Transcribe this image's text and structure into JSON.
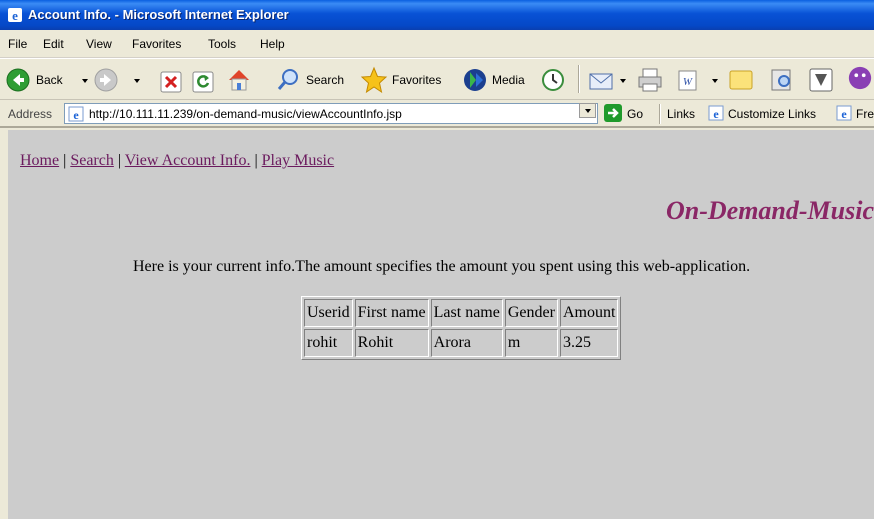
{
  "window": {
    "title": "Account Info. - Microsoft Internet Explorer"
  },
  "menu": [
    "File",
    "Edit",
    "View",
    "Favorites",
    "Tools",
    "Help"
  ],
  "toolbar": {
    "back": "Back",
    "search": "Search",
    "favorites": "Favorites",
    "media": "Media"
  },
  "address": {
    "label": "Address",
    "url": "http://10.111.11.239/on-demand-music/viewAccountInfo.jsp",
    "go": "Go",
    "links": "Links",
    "customize_links": "Customize Links",
    "free": "Fre"
  },
  "page": {
    "nav": [
      "Home",
      "Search",
      "View Account Info.",
      "Play Music"
    ],
    "nav_separator": "|",
    "brand": "On-Demand-Music",
    "info": "Here is your current info.The amount specifies the amount you spent using this web-application.",
    "table": {
      "headers": [
        "Userid",
        "First name",
        "Last name",
        "Gender",
        "Amount"
      ],
      "rows": [
        [
          "rohit",
          "Rohit",
          "Arora",
          "m",
          "3.25"
        ]
      ]
    }
  },
  "colors": {
    "content_bg": "#cccccc",
    "link": "#6b1a5e",
    "brand": "#8a2766",
    "titlebar": "#0852d6"
  },
  "icons": [
    "ie-logo-icon",
    "back-icon",
    "forward-icon",
    "stop-icon",
    "refresh-icon",
    "home-icon",
    "search-icon",
    "favorites-star-icon",
    "media-icon",
    "history-icon",
    "mail-icon",
    "print-icon",
    "edit-icon",
    "discuss-icon",
    "research-icon",
    "messenger-icon",
    "page-icon",
    "go-arrow-icon"
  ]
}
